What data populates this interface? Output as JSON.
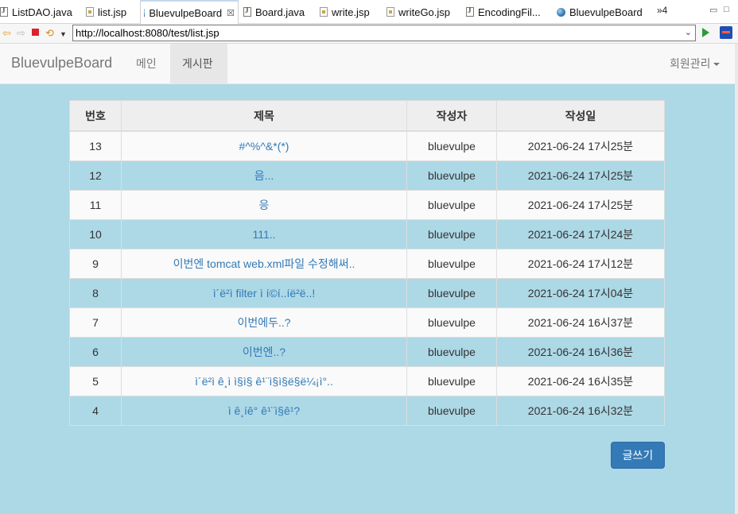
{
  "editor_tabs": [
    {
      "label": "ListDAO.java",
      "icon": "java-file-icon"
    },
    {
      "label": "list.jsp",
      "icon": "jsp-file-icon"
    },
    {
      "label": "BluevulpeBoard",
      "icon": "globe-icon",
      "close": "☒"
    },
    {
      "label": "Board.java",
      "icon": "java-file-icon"
    },
    {
      "label": "write.jsp",
      "icon": "jsp-file-icon"
    },
    {
      "label": "writeGo.jsp",
      "icon": "jsp-file-icon"
    },
    {
      "label": "EncodingFil...",
      "icon": "java-file-icon"
    },
    {
      "label": "BluevulpeBoard",
      "icon": "globe-icon"
    }
  ],
  "tab_overflow": "»4",
  "browser": {
    "url": "http://localhost:8080/test/list.jsp"
  },
  "navbar": {
    "brand": "BluevulpeBoard",
    "links": [
      "메인",
      "게시판"
    ],
    "right_menu": "회원관리"
  },
  "table": {
    "headers": [
      "번호",
      "제목",
      "작성자",
      "작성일"
    ],
    "rows": [
      {
        "no": "13",
        "title": "#^%^&*(*)",
        "writer": "bluevulpe",
        "date": "2021-06-24 17시25분"
      },
      {
        "no": "12",
        "title": "음...",
        "writer": "bluevulpe",
        "date": "2021-06-24 17시25분"
      },
      {
        "no": "11",
        "title": "응",
        "writer": "bluevulpe",
        "date": "2021-06-24 17시25분"
      },
      {
        "no": "10",
        "title": "111..",
        "writer": "bluevulpe",
        "date": "2021-06-24 17시24분"
      },
      {
        "no": "9",
        "title": "이번엔 tomcat web.xml파일 수정해써..",
        "writer": "bluevulpe",
        "date": "2021-06-24 17시12분"
      },
      {
        "no": "8",
        "title": "ì´ë²ì filter ì í©í..íë²ë..!",
        "writer": "bluevulpe",
        "date": "2021-06-24 17시04분"
      },
      {
        "no": "7",
        "title": "이번에두..?",
        "writer": "bluevulpe",
        "date": "2021-06-24 16시37분"
      },
      {
        "no": "6",
        "title": "이번엔..?",
        "writer": "bluevulpe",
        "date": "2021-06-24 16시36분"
      },
      {
        "no": "5",
        "title": "ì´ë²ì ê¸ì ì§ì§ ê¹¨ì§ì§ë§ë¼¡ì°..",
        "writer": "bluevulpe",
        "date": "2021-06-24 16시35분"
      },
      {
        "no": "4",
        "title": "ì ê¸íê° ê¹¨ì§ê¹?",
        "writer": "bluevulpe",
        "date": "2021-06-24 16시32분"
      }
    ]
  },
  "write_button": "글쓰기",
  "colors": {
    "page_bg": "#add8e6",
    "link": "#337ab7",
    "button": "#337ab7"
  }
}
